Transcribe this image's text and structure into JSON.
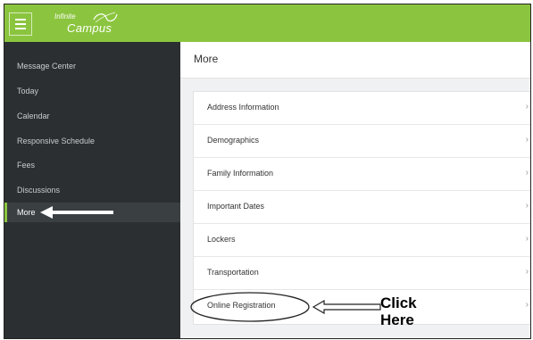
{
  "app": {
    "logo_line1": "Infinite",
    "logo_line2": "Campus"
  },
  "sidebar": {
    "items": [
      {
        "label": "Message Center"
      },
      {
        "label": "Today"
      },
      {
        "label": "Calendar"
      },
      {
        "label": "Responsive Schedule"
      },
      {
        "label": "Fees"
      },
      {
        "label": "Discussions"
      },
      {
        "label": "More",
        "active": true
      }
    ]
  },
  "main": {
    "title": "More",
    "items": [
      {
        "label": "Address Information"
      },
      {
        "label": "Demographics"
      },
      {
        "label": "Family Information"
      },
      {
        "label": "Important Dates"
      },
      {
        "label": "Lockers"
      },
      {
        "label": "Transportation"
      },
      {
        "label": "Online Registration"
      }
    ]
  },
  "annotation": {
    "text": "Click Here",
    "line1": "Click",
    "line2": "Here"
  },
  "colors": {
    "brand_green": "#8bc53f",
    "sidebar_bg": "#2b2f32"
  },
  "icons": {
    "menu": "hamburger-icon",
    "chevron": "chevron-right-icon"
  }
}
